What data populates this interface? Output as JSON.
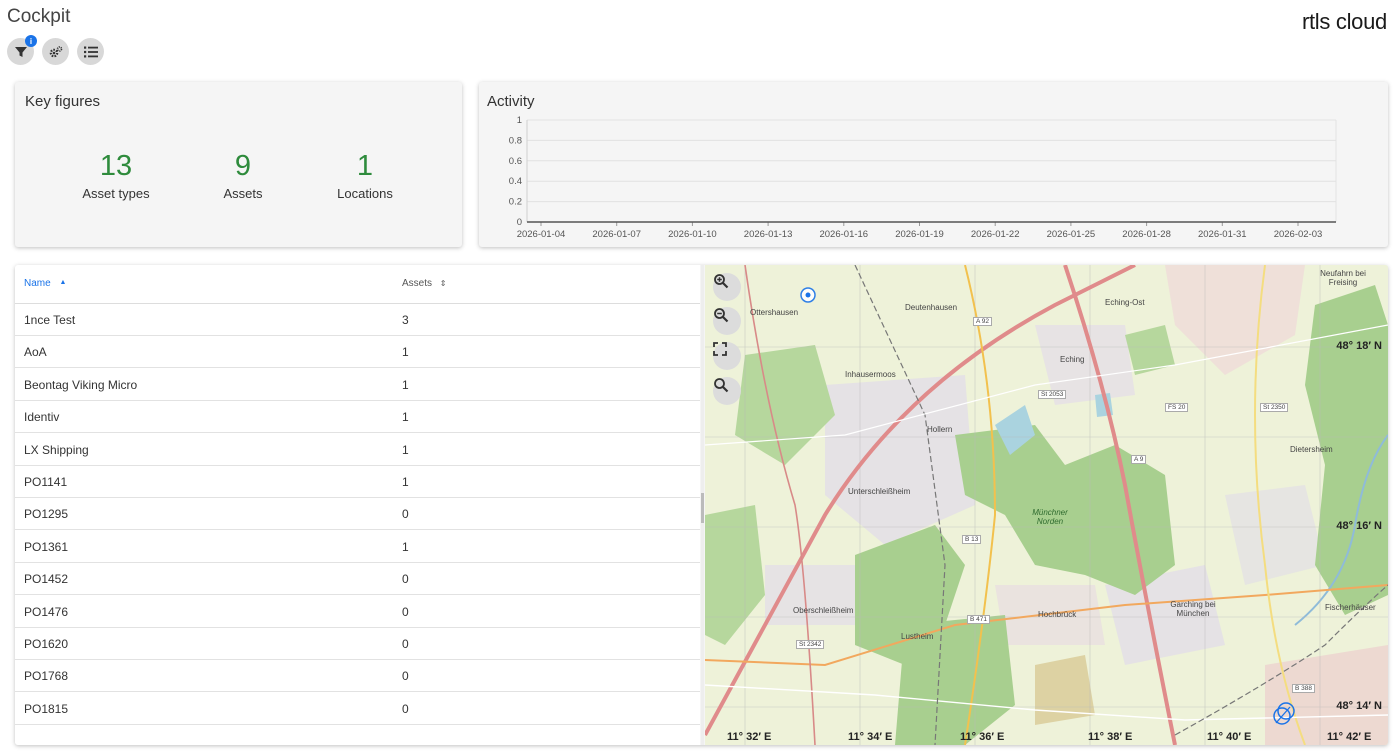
{
  "header": {
    "title": "Cockpit",
    "brand": "rtls cloud",
    "filter_badge": "i"
  },
  "toolbar": {
    "icons": [
      "filter-icon",
      "gears-icon",
      "list-icon"
    ]
  },
  "key_figures": {
    "title": "Key figures",
    "items": [
      {
        "value": "13",
        "label": "Asset types"
      },
      {
        "value": "9",
        "label": "Assets"
      },
      {
        "value": "1",
        "label": "Locations"
      }
    ]
  },
  "activity": {
    "title": "Activity",
    "chart_data": {
      "type": "line",
      "title": "Activity",
      "x": [
        "2026-01-04",
        "2026-01-07",
        "2026-01-10",
        "2026-01-13",
        "2026-01-16",
        "2026-01-19",
        "2026-01-22",
        "2026-01-25",
        "2026-01-28",
        "2026-01-31",
        "2026-02-03"
      ],
      "series": [
        {
          "values": [
            0,
            0,
            0,
            0,
            0,
            0,
            0,
            0,
            0,
            0,
            0
          ]
        }
      ],
      "yticks": [
        "0",
        "0.2",
        "0.4",
        "0.6",
        "0.8",
        "1"
      ],
      "ylim": [
        0,
        1
      ],
      "grid": true
    }
  },
  "table": {
    "columns": [
      {
        "label": "Name",
        "sort": "asc"
      },
      {
        "label": "Assets",
        "sort": "none"
      }
    ],
    "rows": [
      {
        "name": "1nce Test",
        "assets": "3"
      },
      {
        "name": "AoA",
        "assets": "1"
      },
      {
        "name": "Beontag Viking Micro",
        "assets": "1"
      },
      {
        "name": "Identiv",
        "assets": "1"
      },
      {
        "name": "LX Shipping",
        "assets": "1"
      },
      {
        "name": "PO1141",
        "assets": "1"
      },
      {
        "name": "PO1295",
        "assets": "0"
      },
      {
        "name": "PO1361",
        "assets": "1"
      },
      {
        "name": "PO1452",
        "assets": "0"
      },
      {
        "name": "PO1476",
        "assets": "0"
      },
      {
        "name": "PO1620",
        "assets": "0"
      },
      {
        "name": "PO1768",
        "assets": "0"
      },
      {
        "name": "PO1815",
        "assets": "0"
      }
    ]
  },
  "map": {
    "controls": [
      "zoom-in-icon",
      "zoom-out-icon",
      "fullscreen-icon",
      "search-icon"
    ],
    "lat_labels": [
      "48° 18′ N",
      "48° 16′ N",
      "48° 14′ N"
    ],
    "lon_labels": [
      "11° 32′ E",
      "11° 34′ E",
      "11° 36′ E",
      "11° 38′ E",
      "11° 40′ E",
      "11° 42′ E"
    ],
    "places": [
      "Deutenhausen",
      "Neufahrn bei Freising",
      "Ottershausen",
      "Eching-Ost",
      "Eching",
      "Inhausermoos",
      "Hollern",
      "Dietersheim",
      "Unterschleißheim",
      "Münchner Norden",
      "Oberschleißheim",
      "Lustheim",
      "Hochbrück",
      "Garching bei München",
      "Fischerhäuser"
    ],
    "road_tags": [
      "A 92",
      "A 9",
      "St 2053",
      "FS 20",
      "St 2350",
      "B 13",
      "B 471",
      "St 2342",
      "B 388"
    ]
  }
}
